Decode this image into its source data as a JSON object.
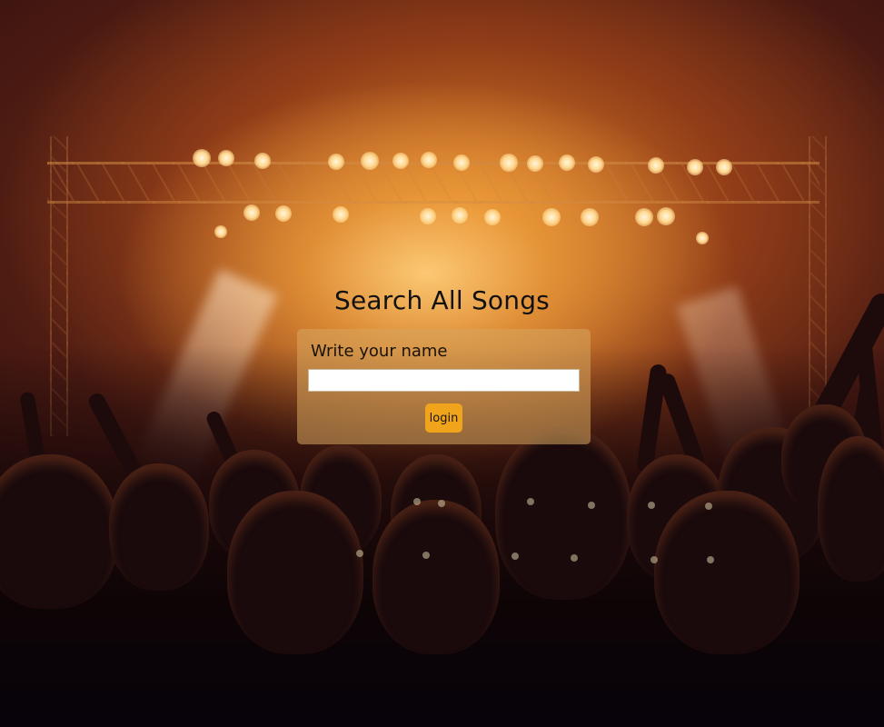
{
  "page": {
    "title": "Search All Songs"
  },
  "login_form": {
    "name_label": "Write your name",
    "name_value": "",
    "name_placeholder": "",
    "login_label": "login"
  },
  "colors": {
    "button": "#f0a41c",
    "input_background": "#ffffff",
    "card_tint": "#d7a55f"
  },
  "background": {
    "image_subject": "concert crowd under orange stage lights"
  }
}
